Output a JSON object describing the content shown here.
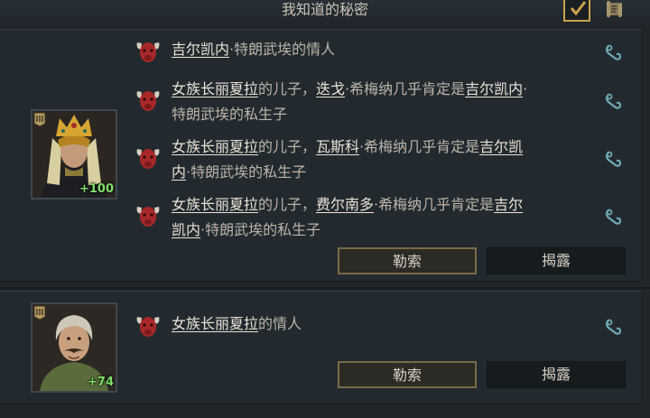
{
  "header": {
    "title": "我知道的秘密"
  },
  "characters": [
    {
      "opinion": "+100",
      "secrets": [
        {
          "parts": [
            {
              "t": "吉尔凯内",
              "h": true
            },
            {
              "t": "·特朗武埃的情人",
              "h": false
            }
          ]
        },
        {
          "parts": [
            {
              "t": "女族长丽夏拉",
              "h": true
            },
            {
              "t": "的儿子，",
              "h": false
            },
            {
              "t": "迭戈",
              "h": true
            },
            {
              "t": "·希梅纳几乎肯定是",
              "h": false
            },
            {
              "t": "吉尔凯内",
              "h": true
            },
            {
              "t": "·特朗武埃的私生子",
              "h": false
            }
          ]
        },
        {
          "parts": [
            {
              "t": "女族长丽夏拉",
              "h": true
            },
            {
              "t": "的儿子，",
              "h": false
            },
            {
              "t": "瓦斯科",
              "h": true
            },
            {
              "t": "·希梅纳几乎肯定是",
              "h": false
            },
            {
              "t": "吉尔凯内",
              "h": true
            },
            {
              "t": "·特朗武埃的私生子",
              "h": false
            }
          ]
        },
        {
          "parts": [
            {
              "t": "女族长丽夏拉",
              "h": true
            },
            {
              "t": "的儿子，",
              "h": false
            },
            {
              "t": "费尔南多",
              "h": true
            },
            {
              "t": "·希梅纳几乎肯定是",
              "h": false
            },
            {
              "t": "吉尔凯内",
              "h": true
            },
            {
              "t": "·特朗武埃的私生子",
              "h": false
            }
          ]
        }
      ],
      "actions": {
        "blackmail": "勒索",
        "expose": "揭露"
      }
    },
    {
      "opinion": "+74",
      "secrets": [
        {
          "parts": [
            {
              "t": "女族长丽夏拉",
              "h": true
            },
            {
              "t": "的情人",
              "h": false
            }
          ]
        }
      ],
      "actions": {
        "blackmail": "勒索",
        "expose": "揭露"
      }
    }
  ],
  "icons": {
    "secret": "red-bull-head-icon",
    "link": "hook-link-icon",
    "checkbox": "checkmark-icon",
    "scroll": "scroll-icon",
    "rank": "rank-badge-icon"
  },
  "colors": {
    "accent_gold": "#c9a24a",
    "secret_red": "#b02a2a",
    "opinion_green": "#7fe06a",
    "link_teal": "#6fa9b5"
  }
}
